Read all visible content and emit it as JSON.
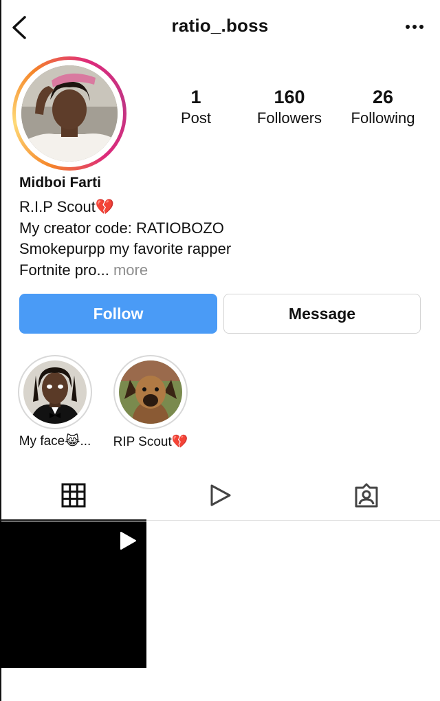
{
  "header": {
    "username": "ratio_.boss",
    "icons": {
      "back": "chevron-left-icon",
      "more": "more-horizontal-icon"
    }
  },
  "profile": {
    "stats": [
      {
        "value": "1",
        "label": "Post"
      },
      {
        "value": "160",
        "label": "Followers"
      },
      {
        "value": "26",
        "label": "Following"
      }
    ],
    "name": "Midboi Farti",
    "bio_lines": [
      "R.I.P Scout💔",
      "My creator code: RATIOBOZO",
      "Smokepurpp my favorite rapper",
      "Fortnite pro..."
    ],
    "bio_more": "more"
  },
  "actions": {
    "follow_label": "Follow",
    "message_label": "Message",
    "follow_color": "#4a9bf6"
  },
  "highlights": [
    {
      "label": "My face😹..."
    },
    {
      "label": "RIP Scout💔"
    }
  ],
  "tabs": [
    {
      "icon": "grid-icon",
      "active": true
    },
    {
      "icon": "reels-play-icon",
      "active": false
    },
    {
      "icon": "tagged-user-icon",
      "active": false
    }
  ],
  "posts": [
    {
      "type": "video",
      "icon": "play-icon"
    }
  ]
}
